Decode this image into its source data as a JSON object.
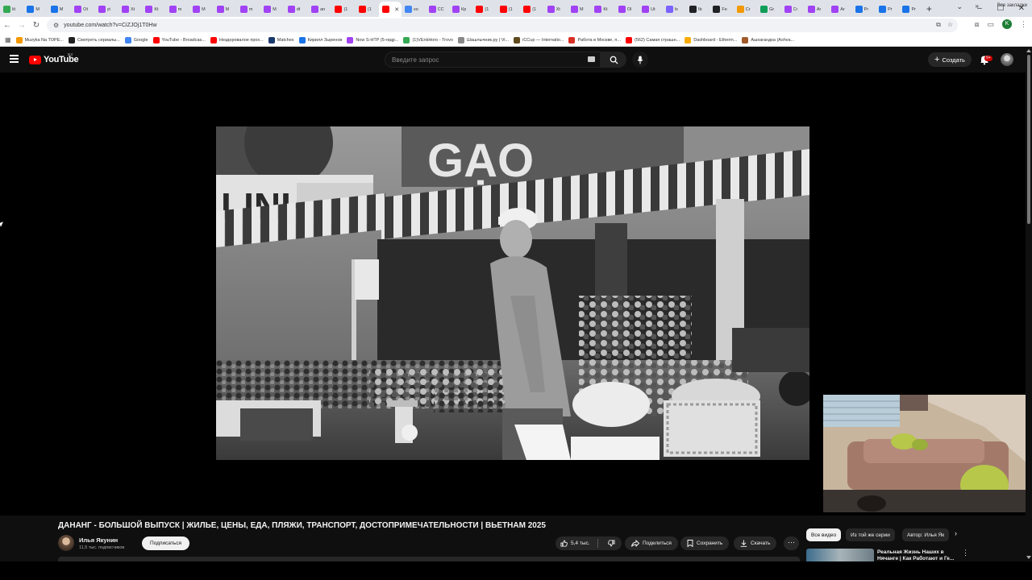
{
  "browser": {
    "tabs": [
      {
        "label": "lit",
        "color": "#34a853"
      },
      {
        "label": "M",
        "color": "#1a73e8"
      },
      {
        "label": "M",
        "color": "#1a73e8"
      },
      {
        "label": "Ot",
        "color": "#a142f4"
      },
      {
        "label": "yt",
        "color": "#a142f4"
      },
      {
        "label": "Xt",
        "color": "#a142f4"
      },
      {
        "label": "Kt",
        "color": "#a142f4"
      },
      {
        "label": "m",
        "color": "#a142f4"
      },
      {
        "label": "M",
        "color": "#a142f4"
      },
      {
        "label": "M",
        "color": "#a142f4"
      },
      {
        "label": "m",
        "color": "#a142f4"
      },
      {
        "label": "M",
        "color": "#a142f4"
      },
      {
        "label": "dt",
        "color": "#a142f4"
      },
      {
        "label": "an",
        "color": "#a142f4"
      },
      {
        "label": "(1",
        "color": "#ff0000"
      },
      {
        "label": "(1",
        "color": "#ff0000"
      },
      {
        "label": "",
        "color": "#ff0000",
        "active": true
      },
      {
        "label": "ко",
        "color": "#4285f4"
      },
      {
        "label": "СС",
        "color": "#a142f4"
      },
      {
        "label": "Кр",
        "color": "#a142f4"
      },
      {
        "label": "(1",
        "color": "#ff0000"
      },
      {
        "label": "(1",
        "color": "#ff0000"
      },
      {
        "label": "(1",
        "color": "#ff0000"
      },
      {
        "label": "Xt",
        "color": "#a142f4"
      },
      {
        "label": "M",
        "color": "#a142f4"
      },
      {
        "label": "Kt",
        "color": "#a142f4"
      },
      {
        "label": "Ol",
        "color": "#a142f4"
      },
      {
        "label": "Ut",
        "color": "#a142f4"
      },
      {
        "label": "Ix",
        "color": "#7b61ff"
      },
      {
        "label": "Ib",
        "color": "#202124"
      },
      {
        "label": "Fe",
        "color": "#202124"
      },
      {
        "label": "Cr",
        "color": "#f29900"
      },
      {
        "label": "Gr",
        "color": "#0f9d58"
      },
      {
        "label": "Cr",
        "color": "#a142f4"
      },
      {
        "label": "Ar",
        "color": "#a142f4"
      },
      {
        "label": "Ar",
        "color": "#a142f4"
      },
      {
        "label": "Pr",
        "color": "#1a73e8"
      },
      {
        "label": "Pr",
        "color": "#1a73e8"
      },
      {
        "label": "Pr",
        "color": "#1a73e8"
      }
    ],
    "new_tab": "+",
    "url": "youtube.com/watch?v=CiZJOj1T0Hw",
    "profile_letter": "K",
    "bookmarks": [
      {
        "label": "Muzyka Na TOPE...",
        "color": "#f29900"
      },
      {
        "label": "Смотреть сериалы...",
        "color": "#202124"
      },
      {
        "label": "Google",
        "color": "#4285f4"
      },
      {
        "label": "YouTube - Broadcas...",
        "color": "#ff0000"
      },
      {
        "label": "Нездоровалое прох...",
        "color": "#ff0000"
      },
      {
        "label": "Matches",
        "color": "#1a3a6e"
      },
      {
        "label": "Кирилл Зыренов",
        "color": "#1a73e8"
      },
      {
        "label": "Now S-HTP (5-гидр...",
        "color": "#a142f4"
      },
      {
        "label": "(1)VEnkHoro - Trovo",
        "color": "#34a853"
      },
      {
        "label": "Шашлычник.ру | Vi...",
        "color": "#888888"
      },
      {
        "label": "iCCup — Internatio...",
        "color": "#5f4b1e"
      },
      {
        "label": "Работа в Москве, п...",
        "color": "#d93025"
      },
      {
        "label": "(562) Самая страшн...",
        "color": "#ff0000"
      },
      {
        "label": "Dashboard - Etherm...",
        "color": "#f9ab00"
      },
      {
        "label": "Ашхагандка (Ashva...",
        "color": "#a05a2c"
      }
    ],
    "all_bookmarks": "Все закладки"
  },
  "youtube": {
    "logo_text": "YouTube",
    "country_code": "BY",
    "search_placeholder": "Введите запрос",
    "create_label": "Создать",
    "notifications_badge": "9+",
    "video": {
      "title": "ДАНАНГ - БОЛЬШОЙ ВЫПУСК | ЖИЛЬЕ, ЦЕНЫ, ЕДА, ПЛЯЖИ, ТРАНСПОРТ, ДОСТОПРИМЕЧАТЕЛЬНОСТИ | ВЬЕТНАМ 2025",
      "sign_text": "GẠO"
    },
    "channel": {
      "name": "Илья Якунин",
      "subscribers": "11,5 тыс. подписчиков",
      "subscribe_label": "Подписаться"
    },
    "actions": {
      "likes": "5,4 тыс.",
      "share": "Поделиться",
      "save": "Сохранить",
      "download": "Скачать",
      "more": "⋯"
    },
    "chips": [
      "Все видео",
      "Из той же серии",
      "Автор: Илья Як"
    ],
    "recommendation": {
      "title": "Реальная Жизнь Наших в Нячанге | Как Работают и Ге..."
    }
  }
}
